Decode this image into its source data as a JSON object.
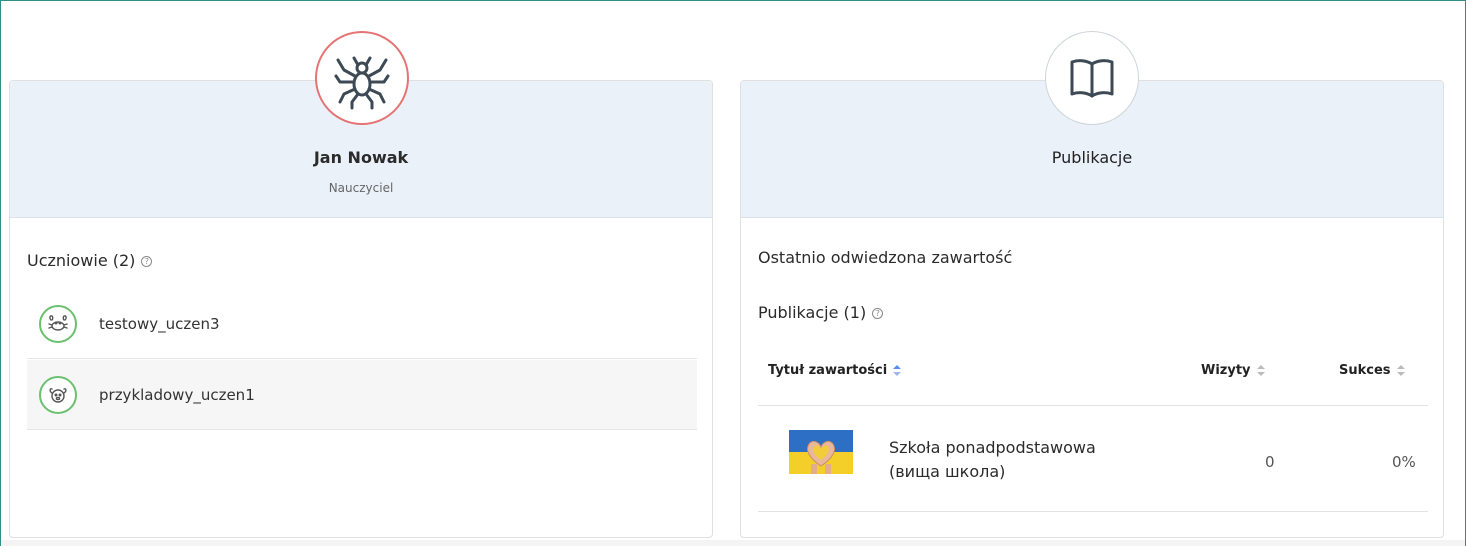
{
  "profile": {
    "name": "Jan Nowak",
    "role": "Nauczyciel",
    "avatar_icon": "spider-icon"
  },
  "students": {
    "title": "Uczniowie (2)",
    "help": "?",
    "items": [
      {
        "name": "testowy_uczen3",
        "avatar_icon": "crab-icon"
      },
      {
        "name": "przykladowy_uczen1",
        "avatar_icon": "dog-icon"
      }
    ]
  },
  "publications_card": {
    "title": "Publikacje",
    "avatar_icon": "book-icon",
    "recent_title": "Ostatnio odwiedzona zawartość",
    "list_title": "Publikacje (1)",
    "help": "?",
    "columns": {
      "title": "Tytuł zawartości",
      "visits": "Wizyty",
      "success": "Sukces"
    },
    "rows": [
      {
        "title_line1": "Szkoła ponadpodstawowa",
        "title_line2": "(вища школа)",
        "visits": "0",
        "success": "0%",
        "thumbnail_icon": "ukraine-flag-heart-hands-thumbnail"
      }
    ]
  },
  "colors": {
    "frame_border": "#2c8f8a",
    "card_header_bg": "#eaf1f9",
    "teacher_avatar_ring": "#e57373",
    "student_avatar_ring": "#6cc070",
    "sort_active": "#5b8def"
  }
}
